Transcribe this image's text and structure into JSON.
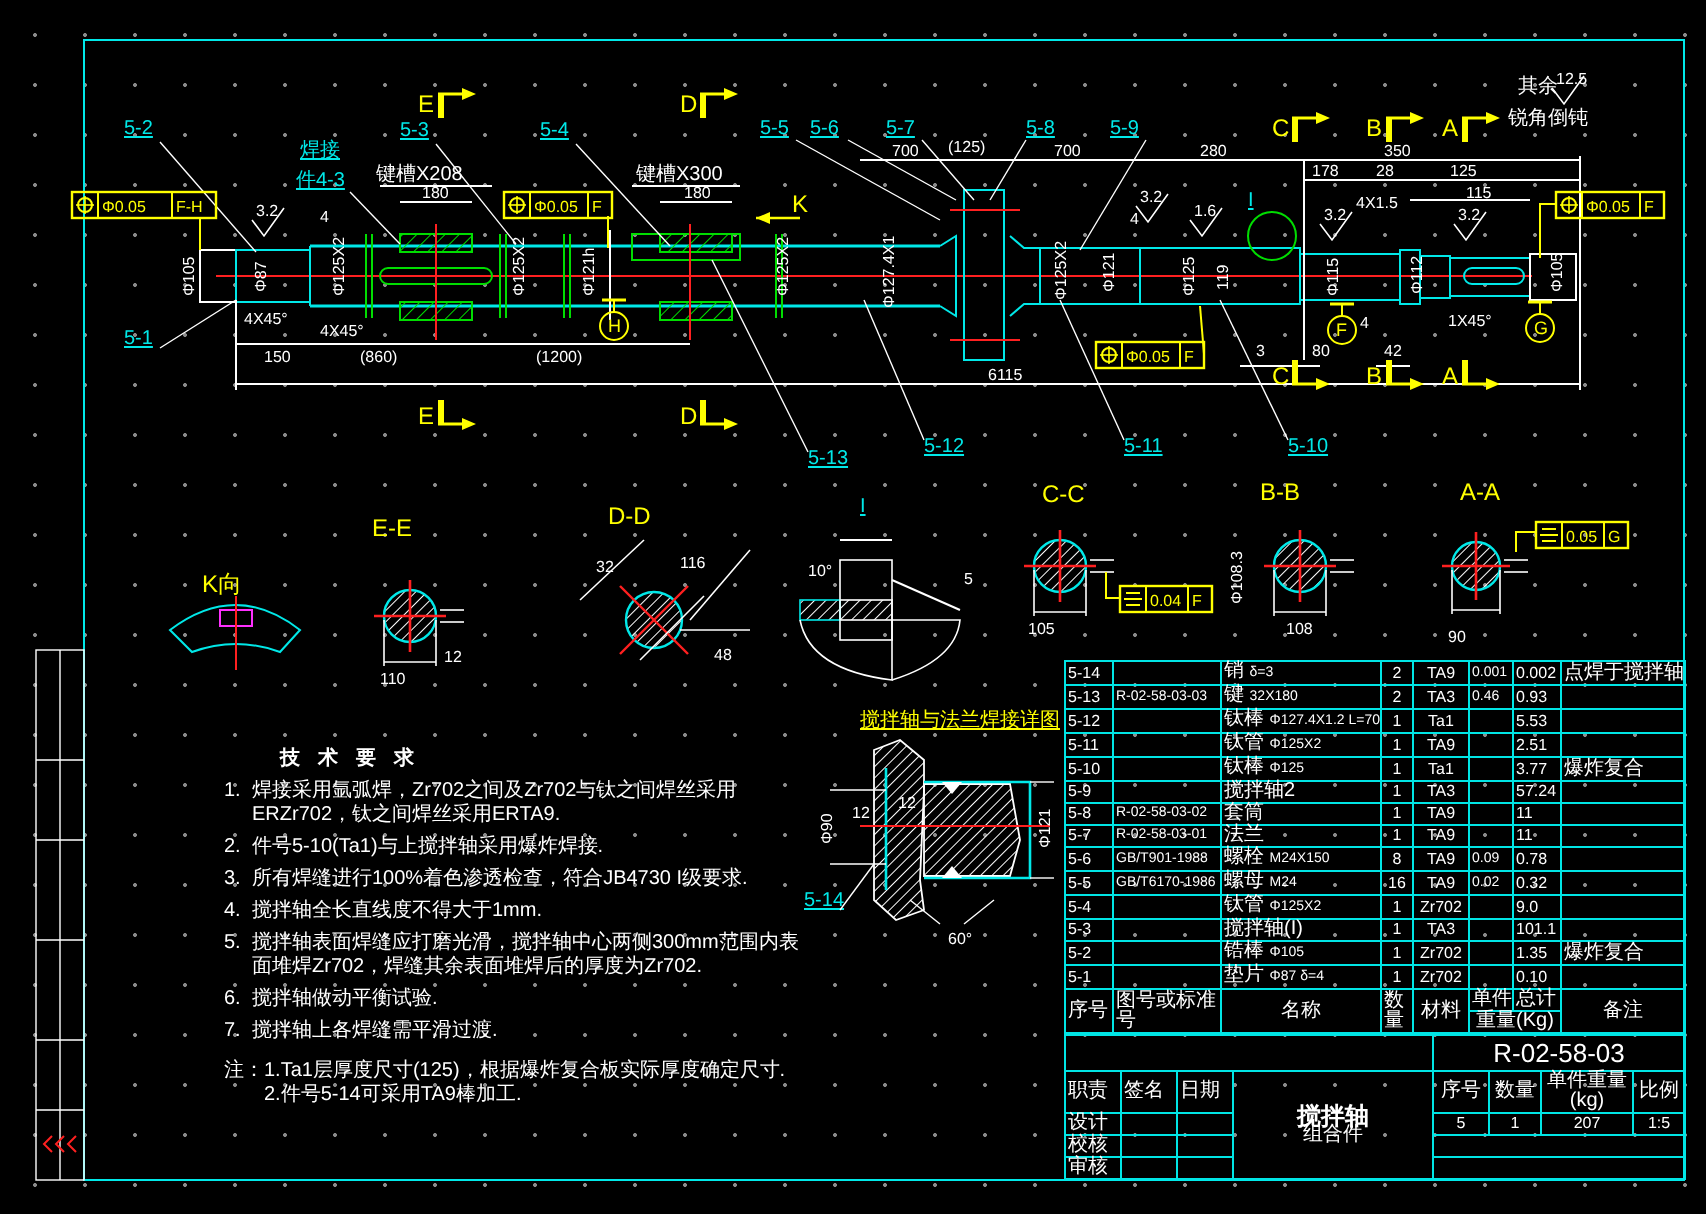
{
  "sheet": {
    "labels": [
      {
        "kind": "note",
        "text": "其余"
      },
      {
        "kind": "roughness",
        "text": "12.5"
      },
      {
        "kind": "note",
        "text": "锐角倒钝"
      },
      {
        "kind": "section",
        "text": "E"
      },
      {
        "kind": "section",
        "text": "D"
      },
      {
        "kind": "section",
        "text": "C"
      },
      {
        "kind": "section",
        "text": "B"
      },
      {
        "kind": "section",
        "text": "A"
      },
      {
        "kind": "section",
        "text": "E"
      },
      {
        "kind": "section",
        "text": "D"
      },
      {
        "kind": "section",
        "text": "C"
      },
      {
        "kind": "section",
        "text": "B"
      },
      {
        "kind": "section",
        "text": "A"
      },
      {
        "kind": "section",
        "text": "K"
      },
      {
        "kind": "callout",
        "text": "5-2"
      },
      {
        "kind": "callout",
        "text": "5-1"
      },
      {
        "kind": "callout",
        "text": "5-3"
      },
      {
        "kind": "callout",
        "text": "5-4"
      },
      {
        "kind": "callout",
        "text": "5-5"
      },
      {
        "kind": "callout",
        "text": "5-6"
      },
      {
        "kind": "callout",
        "text": "5-7"
      },
      {
        "kind": "callout",
        "text": "5-8"
      },
      {
        "kind": "callout",
        "text": "5-9"
      },
      {
        "kind": "callout",
        "text": "5-13"
      },
      {
        "kind": "callout",
        "text": "5-12"
      },
      {
        "kind": "callout",
        "text": "5-11"
      },
      {
        "kind": "callout",
        "text": "5-10"
      },
      {
        "kind": "callout",
        "text": "I"
      },
      {
        "kind": "callout",
        "text": "焊接"
      },
      {
        "kind": "callout",
        "text": "件4-3"
      },
      {
        "kind": "dimension",
        "text": "Φ105"
      },
      {
        "kind": "dimension",
        "text": "Φ87"
      },
      {
        "kind": "dimension",
        "text": "4"
      },
      {
        "kind": "dimension",
        "text": "4X45°"
      },
      {
        "kind": "dimension",
        "text": "4X45°"
      },
      {
        "kind": "dimension",
        "text": "150"
      },
      {
        "kind": "dimension",
        "text": "(860)"
      },
      {
        "kind": "dimension",
        "text": "(1200)"
      },
      {
        "kind": "note",
        "text": "键槽X208"
      },
      {
        "kind": "dimension",
        "text": "180"
      },
      {
        "kind": "dimension",
        "text": "Φ125X2"
      },
      {
        "kind": "dimension",
        "text": "Φ125X2"
      },
      {
        "kind": "dimension",
        "text": "Φ121h"
      },
      {
        "kind": "note",
        "text": "键槽X300"
      },
      {
        "kind": "dimension",
        "text": "180"
      },
      {
        "kind": "dimension",
        "text": "Φ125X2"
      },
      {
        "kind": "dimension",
        "text": "Φ127.4X1"
      },
      {
        "kind": "dimension",
        "text": "700"
      },
      {
        "kind": "dimension",
        "text": "(125)"
      },
      {
        "kind": "dimension",
        "text": "700"
      },
      {
        "kind": "dimension",
        "text": "6115"
      },
      {
        "kind": "dimension",
        "text": "280"
      },
      {
        "kind": "dimension",
        "text": "350"
      },
      {
        "kind": "dimension",
        "text": "178"
      },
      {
        "kind": "dimension",
        "text": "28"
      },
      {
        "kind": "dimension",
        "text": "125"
      },
      {
        "kind": "dimension",
        "text": "4X1.5"
      },
      {
        "kind": "dimension",
        "text": "115"
      },
      {
        "kind": "dimension",
        "text": "4"
      },
      {
        "kind": "dimension",
        "text": "Φ125X2"
      },
      {
        "kind": "dimension",
        "text": "Φ121"
      },
      {
        "kind": "dimension",
        "text": "Φ125"
      },
      {
        "kind": "dimension",
        "text": "119"
      },
      {
        "kind": "dimension",
        "text": "Φ115"
      },
      {
        "kind": "dimension",
        "text": "Φ112"
      },
      {
        "kind": "dimension",
        "text": "Φ105"
      },
      {
        "kind": "dimension",
        "text": "3"
      },
      {
        "kind": "dimension",
        "text": "80"
      },
      {
        "kind": "dimension",
        "text": "4"
      },
      {
        "kind": "dimension",
        "text": "42"
      },
      {
        "kind": "dimension",
        "text": "1X45°"
      },
      {
        "kind": "roughness",
        "text": "3.2"
      },
      {
        "kind": "roughness",
        "text": "3.2"
      },
      {
        "kind": "roughness",
        "text": "1.6"
      },
      {
        "kind": "roughness",
        "text": "3.2"
      },
      {
        "kind": "roughness",
        "text": "3.2"
      },
      {
        "kind": "datum",
        "text": "H"
      },
      {
        "kind": "datum",
        "text": "F"
      },
      {
        "kind": "datum",
        "text": "G"
      },
      {
        "kind": "view",
        "text": "K向"
      },
      {
        "kind": "view",
        "text": "E-E"
      },
      {
        "kind": "view",
        "text": "D-D"
      },
      {
        "kind": "callout",
        "text": "I"
      },
      {
        "kind": "view",
        "text": "C-C"
      },
      {
        "kind": "view",
        "text": "B-B"
      },
      {
        "kind": "view",
        "text": "A-A"
      },
      {
        "kind": "dimension",
        "text": "110"
      },
      {
        "kind": "dimension",
        "text": "12"
      },
      {
        "kind": "dimension",
        "text": "32"
      },
      {
        "kind": "dimension",
        "text": "116"
      },
      {
        "kind": "dimension",
        "text": "48"
      },
      {
        "kind": "dimension",
        "text": "10°"
      },
      {
        "kind": "dimension",
        "text": "5"
      },
      {
        "kind": "dimension",
        "text": "105"
      },
      {
        "kind": "dimension",
        "text": "108"
      },
      {
        "kind": "dimension",
        "text": "Φ108.3"
      },
      {
        "kind": "dimension",
        "text": "90"
      },
      {
        "kind": "title",
        "text": "搅拌轴与法兰焊接详图"
      },
      {
        "kind": "dimension",
        "text": "Φ90"
      },
      {
        "kind": "dimension",
        "text": "12"
      },
      {
        "kind": "dimension",
        "text": "12"
      },
      {
        "kind": "dimension",
        "text": "Φ121"
      },
      {
        "kind": "dimension",
        "text": "60°"
      },
      {
        "kind": "callout",
        "text": "5-14"
      }
    ],
    "tolerance_frames": [
      {
        "kind": "position",
        "value": "Φ0.05",
        "datum": "F-H"
      },
      {
        "kind": "position",
        "value": "Φ0.05",
        "datum": "F"
      },
      {
        "kind": "position",
        "value": "Φ0.05",
        "datum": "F"
      },
      {
        "kind": "position",
        "value": "Φ0.05",
        "datum": "F"
      },
      {
        "kind": "symmetry",
        "value": "0.04",
        "datum": "F"
      },
      {
        "kind": "symmetry",
        "value": "0.05",
        "datum": "G"
      }
    ]
  },
  "requirements": {
    "title": "技术要求",
    "items": [
      {
        "number": "1.",
        "text": "焊接采用氩弧焊，Zr702之间及Zr702与钛之间焊丝采用ERZr702，钛之间焊丝采用ERTA9."
      },
      {
        "number": "2.",
        "text": "件号5-10(Ta1)与上搅拌轴采用爆炸焊接."
      },
      {
        "number": "3.",
        "text": "所有焊缝进行100%着色渗透检查，符合JB4730 I级要求."
      },
      {
        "number": "4.",
        "text": "搅拌轴全长直线度不得大于1mm."
      },
      {
        "number": "5.",
        "text": "搅拌轴表面焊缝应打磨光滑，搅拌轴中心两侧300mm范围内表面堆焊Zr702，焊缝其余表面堆焊后的厚度为Zr702."
      },
      {
        "number": "6.",
        "text": "搅拌轴做动平衡试验."
      },
      {
        "number": "7.",
        "text": "搅拌轴上各焊缝需平滑过渡."
      }
    ],
    "notes_label": "注：",
    "notes": [
      "1.Ta1层厚度尺寸(125)，根据爆炸复合板实际厚度确定尺寸.",
      "2.件号5-14可采用TA9棒加工."
    ]
  },
  "parts_table": {
    "rows": [
      {
        "no": "5-14",
        "name": "销",
        "spec": "δ=3",
        "qty": "2",
        "material": "TA9",
        "unit_weight": "0.001",
        "total_weight": "0.002",
        "remark": "点焊于搅拌轴"
      },
      {
        "no": "5-13",
        "drawing_no": "R-02-58-03-03",
        "name": "键",
        "spec": "32X180",
        "qty": "2",
        "material": "TA3",
        "unit_weight": "0.46",
        "total_weight": "0.93"
      },
      {
        "no": "5-12",
        "name": "钛棒",
        "spec": "Φ127.4X1.2 L=70",
        "qty": "1",
        "material": "Ta1",
        "total_weight": "5.53"
      },
      {
        "no": "5-11",
        "name": "钛管",
        "spec": "Φ125X2",
        "qty": "1",
        "material": "TA9",
        "total_weight": "2.51"
      },
      {
        "no": "5-10",
        "name": "钛棒",
        "spec": "Φ125",
        "qty": "1",
        "material": "Ta1",
        "total_weight": "3.77",
        "remark": "爆炸复合"
      },
      {
        "no": "5-9",
        "name": "搅拌轴2",
        "qty": "1",
        "material": "TA3",
        "total_weight": "57.24"
      },
      {
        "no": "5-8",
        "drawing_no": "R-02-58-03-02",
        "name": "套筒",
        "qty": "1",
        "material": "TA9",
        "total_weight": "11"
      },
      {
        "no": "5-7",
        "drawing_no": "R-02-58-03-01",
        "name": "法兰",
        "qty": "1",
        "material": "TA9",
        "total_weight": "11"
      },
      {
        "no": "5-6",
        "drawing_no": "GB/T901-1988",
        "name": "螺栓",
        "spec": "M24X150",
        "qty": "8",
        "material": "TA9",
        "unit_weight": "0.09",
        "total_weight": "0.78"
      },
      {
        "no": "5-5",
        "drawing_no": "GB/T6170-1986",
        "name": "螺母",
        "spec": "M24",
        "qty": "16",
        "material": "TA9",
        "unit_weight": "0.02",
        "total_weight": "0.32"
      },
      {
        "no": "5-4",
        "name": "钛管",
        "spec": "Φ125X2",
        "qty": "1",
        "material": "Zr702",
        "total_weight": "9.0"
      },
      {
        "no": "5-3",
        "name": "搅拌轴(I)",
        "qty": "1",
        "material": "TA3",
        "total_weight": "101.1"
      },
      {
        "no": "5-2",
        "name": "锆棒",
        "spec": "Φ105",
        "qty": "1",
        "material": "Zr702",
        "total_weight": "1.35",
        "remark": "爆炸复合"
      },
      {
        "no": "5-1",
        "name": "垫片",
        "spec": "Φ87 δ=4",
        "qty": "1",
        "material": "Zr702",
        "total_weight": "0.10"
      }
    ],
    "header": {
      "no": "序号",
      "drawing_no": "图号或标准号",
      "name": "名称",
      "qty": "数量",
      "material": "材料",
      "unit": "单件",
      "total": "总计",
      "weight": "重量(Kg)",
      "remark": "备注"
    }
  },
  "title_block": {
    "drawing_no": "R-02-58-03",
    "sign_headers": [
      "职责",
      "签名",
      "日期"
    ],
    "sign_rows": [
      "设计",
      "校核",
      "审核"
    ],
    "name": "搅拌轴",
    "subtitle": "组合件",
    "info_headers": [
      "序号",
      "数量",
      "单件重量(kg)",
      "比例"
    ],
    "info_values": [
      "5",
      "1",
      "207",
      "1:5"
    ]
  }
}
